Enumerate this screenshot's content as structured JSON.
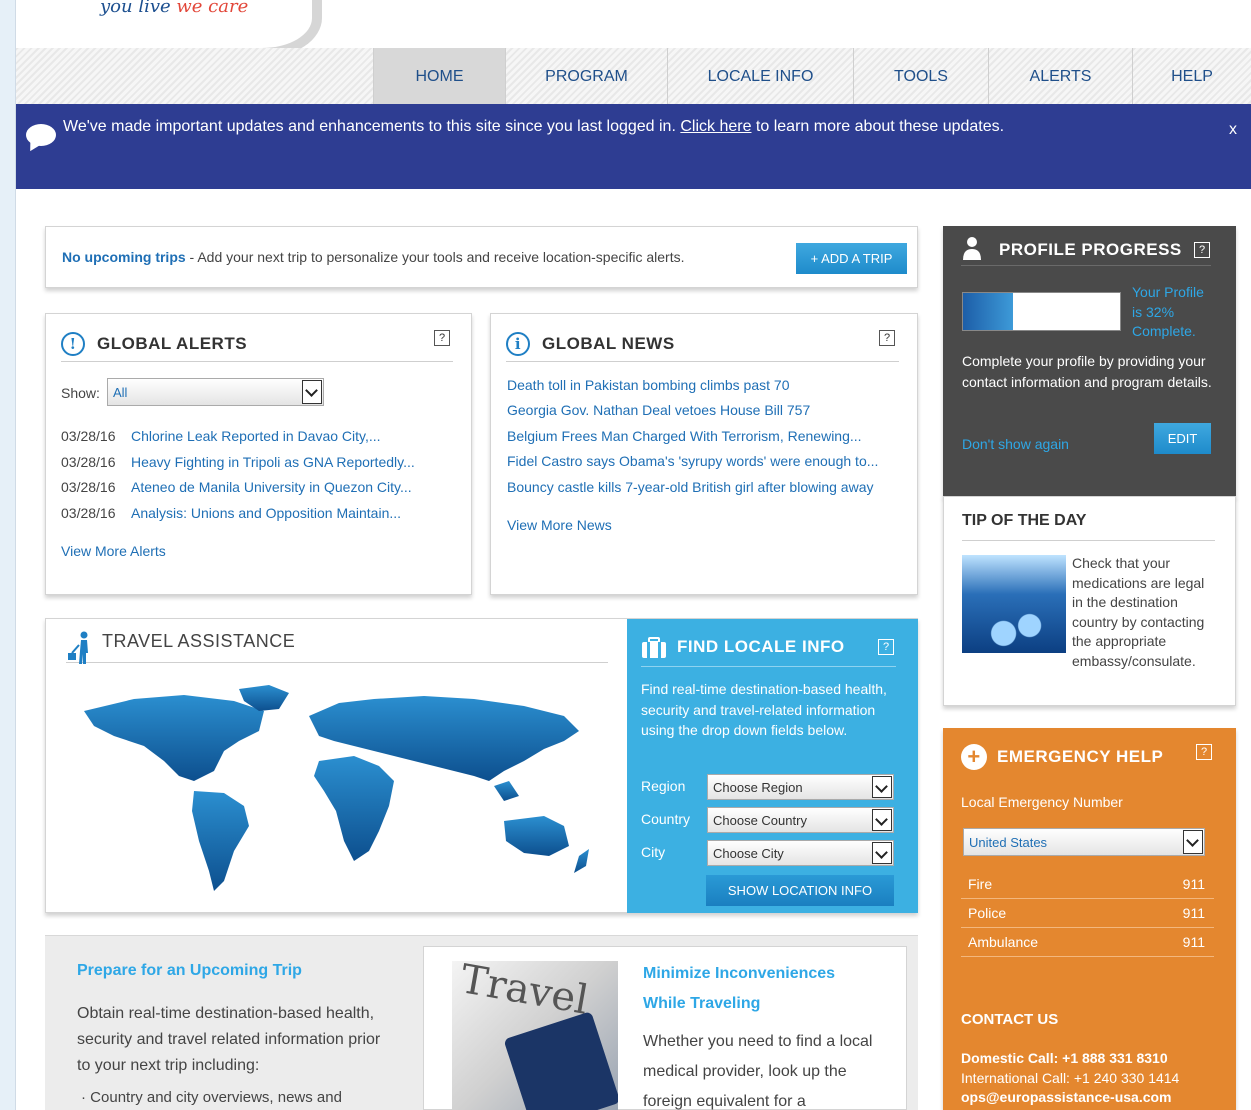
{
  "brand": {
    "tagline_a": "you live",
    "tagline_b": "we care"
  },
  "nav": {
    "items": [
      "HOME",
      "PROGRAM",
      "LOCALE INFO",
      "TOOLS",
      "ALERTS",
      "HELP"
    ],
    "active": "HOME"
  },
  "banner": {
    "message_pre": "We've made important updates and enhancements to this site since you last logged in. ",
    "link": "Click here",
    "message_post": " to learn more about these updates.",
    "close": "x"
  },
  "trips": {
    "label": "No upcoming trips",
    "text": " - Add your next trip to personalize your tools and receive location-specific alerts.",
    "button": "+ ADD A TRIP"
  },
  "global_alerts": {
    "title": "GLOBAL ALERTS",
    "help": "?",
    "show_label": "Show:",
    "filter": "All",
    "items": [
      {
        "date": "03/28/16",
        "title": "Chlorine Leak Reported in Davao City,..."
      },
      {
        "date": "03/28/16",
        "title": "Heavy Fighting in Tripoli as GNA Reportedly..."
      },
      {
        "date": "03/28/16",
        "title": "Ateneo de Manila University in Quezon City..."
      },
      {
        "date": "03/28/16",
        "title": "Analysis: Unions and Opposition Maintain..."
      }
    ],
    "more": "View More Alerts"
  },
  "global_news": {
    "title": "GLOBAL NEWS",
    "help": "?",
    "items": [
      "Death toll in Pakistan bombing climbs past 70",
      "Georgia Gov. Nathan Deal vetoes House Bill 757",
      "Belgium Frees Man Charged With Terrorism, Renewing...",
      "Fidel Castro says Obama's 'syrupy words' were enough to...",
      "Bouncy castle kills 7-year-old British girl after blowing away"
    ],
    "more": "View More News"
  },
  "travel_assistance": {
    "title": "TRAVEL ASSISTANCE",
    "map": "world-map"
  },
  "find_locale": {
    "title": "FIND LOCALE INFO",
    "help": "?",
    "description": "Find real-time destination-based health, security and travel-related information using the drop down fields below.",
    "region_label": "Region",
    "region_value": "Choose Region",
    "country_label": "Country",
    "country_value": "Choose Country",
    "city_label": "City",
    "city_value": "Choose City",
    "button": "SHOW LOCATION INFO"
  },
  "profile": {
    "title": "PROFILE PROGRESS",
    "help": "?",
    "percent_complete": 32,
    "status": "Your Profile is 32% Complete.",
    "description": "Complete your profile by providing your contact information and program details.",
    "dismiss": "Don't show again",
    "edit": "EDIT"
  },
  "tip": {
    "title": "TIP OF THE DAY",
    "text": "Check that your medications are legal in the destination country by contacting the appropriate embassy/consulate."
  },
  "emergency": {
    "title": "EMERGENCY HELP",
    "help": "?",
    "local_label": "Local Emergency Number",
    "country": "United States",
    "numbers": [
      {
        "name": "Fire",
        "number": "911"
      },
      {
        "name": "Police",
        "number": "911"
      },
      {
        "name": "Ambulance",
        "number": "911"
      }
    ],
    "contact_title": "CONTACT US",
    "domestic": "Domestic Call: +1 888 331 8310",
    "international": "International Call: +1 240 330 1414",
    "email": "ops@europassistance-usa.com"
  },
  "prepare": {
    "title": "Prepare for an Upcoming Trip",
    "text": "Obtain real-time destination-based health, security and travel related information prior to your next trip including:",
    "bullet": "Country and city overviews, news and"
  },
  "minimize": {
    "title": "Minimize Inconveniences While Traveling",
    "text": "Whether you need to find a local medical provider, look up the foreign equivalent for a",
    "image_word": "Travel"
  },
  "colors": {
    "banner": "#2e3d92",
    "accent": "#3cb0e2",
    "profile_bg": "#4a4a4a",
    "emergency_bg": "#e4872f"
  }
}
